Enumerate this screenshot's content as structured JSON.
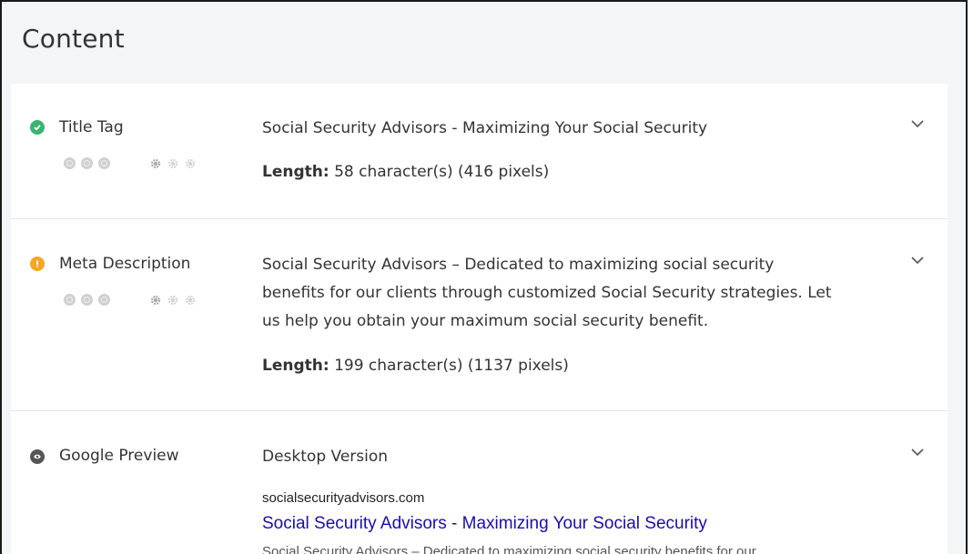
{
  "section": {
    "title": "Content"
  },
  "rows": [
    {
      "label": "Title Tag",
      "status": "pass",
      "status_color": "#3cb371",
      "value": "Social Security Advisors - Maximizing Your Social Security",
      "length_label": "Length:",
      "length_value": " 58 character(s) (416 pixels)"
    },
    {
      "label": "Meta Description",
      "status": "warning",
      "status_color": "#f5a623",
      "value_lines": [
        "Social Security Advisors – Dedicated to maximizing social security",
        "benefits for our clients through customized Social Security strategies. Let",
        "us help you obtain your maximum social security benefit."
      ],
      "length_label": "Length:",
      "length_value": " 199 character(s) (1137 pixels)"
    },
    {
      "label": "Google Preview",
      "status": "info",
      "status_color": "#555555",
      "version": "Desktop Version",
      "preview": {
        "url": "socialsecurityadvisors.com",
        "title": "Social Security Advisors - Maximizing Your Social Security",
        "description": "Social Security Advisors – Dedicated to maximizing social security benefits for our"
      }
    }
  ],
  "icons": {
    "importance": [
      "target-icon",
      "target-icon",
      "target-icon"
    ],
    "difficulty": [
      "gear-icon",
      "gear-icon",
      "gear-icon"
    ],
    "expand": "chevron-down-icon"
  }
}
